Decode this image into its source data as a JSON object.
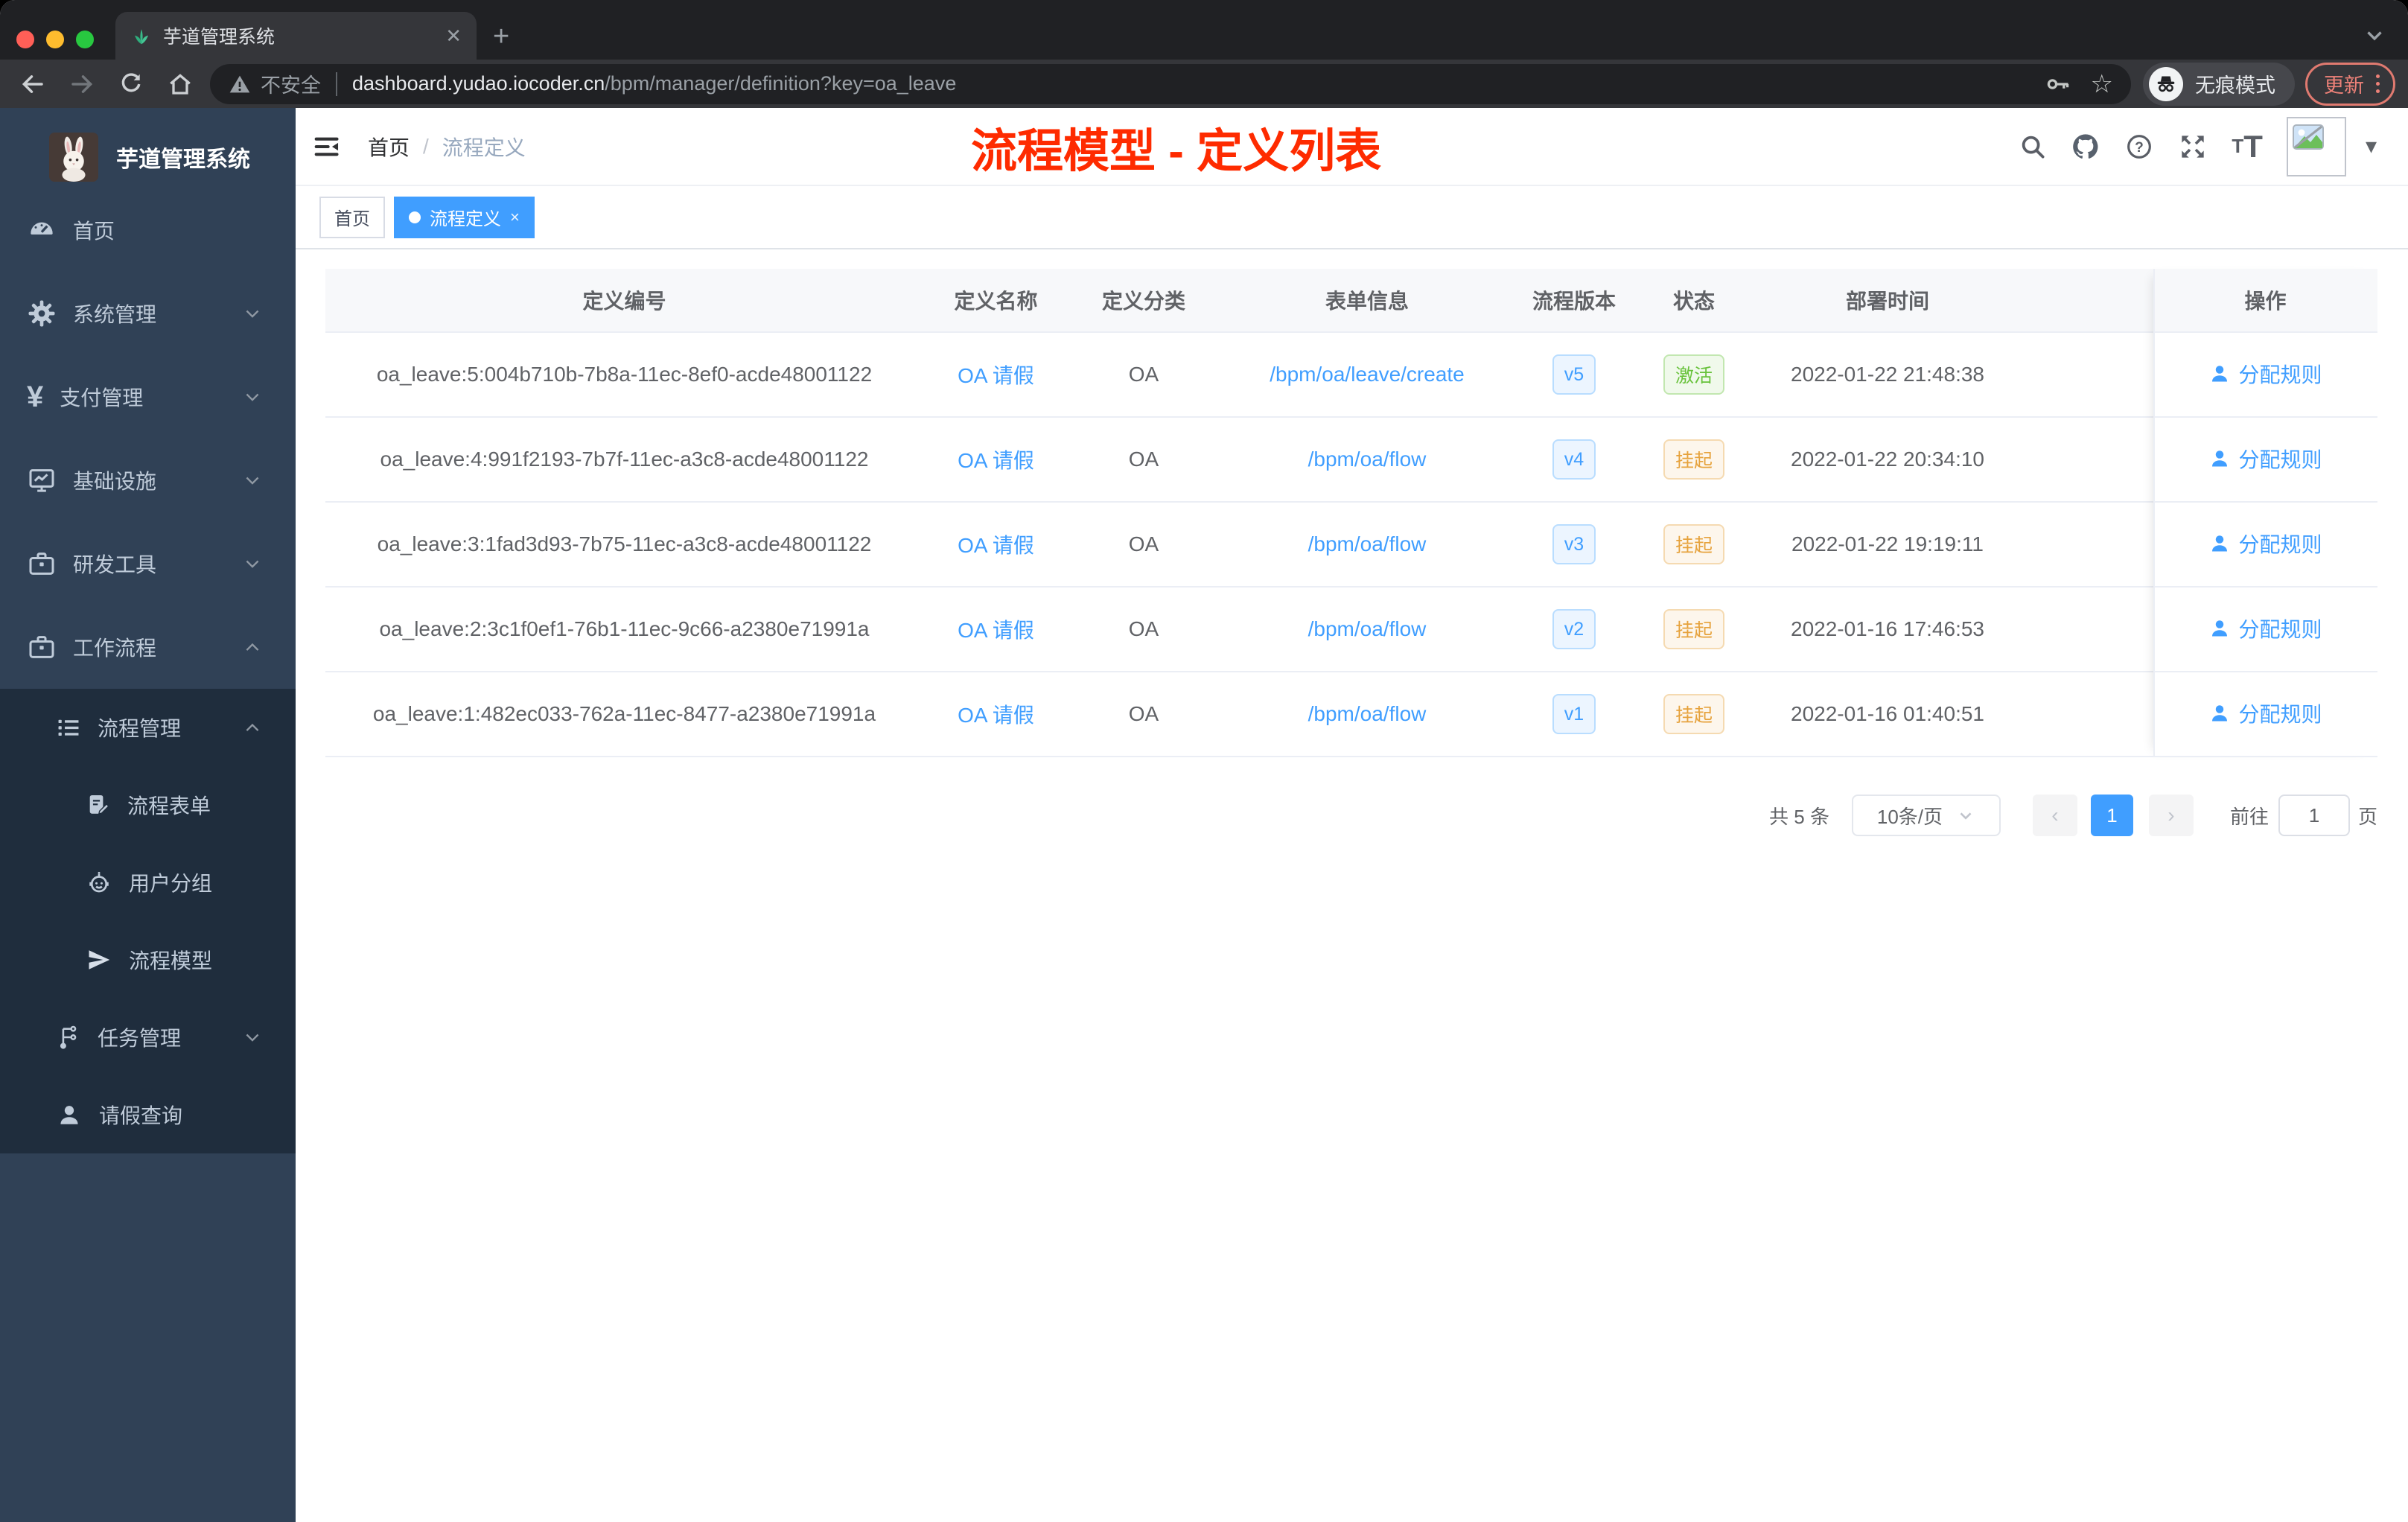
{
  "browser": {
    "tab": {
      "title": "芋道管理系统",
      "favicon": "sprout-icon",
      "close_glyph": "✕",
      "new_tab_glyph": "+"
    },
    "toolbar": {
      "insecure_label": "不安全",
      "url_domain": "dashboard.yudao.iocoder.cn",
      "url_path": "/bpm/manager/definition?key=oa_leave",
      "incognito_label": "无痕模式",
      "update_label": "更新"
    }
  },
  "sidebar": {
    "title": "芋道管理系统",
    "menu": [
      {
        "label": "首页",
        "icon": "dashboard-icon",
        "level": 1
      },
      {
        "label": "系统管理",
        "icon": "gear-icon",
        "level": 1,
        "chevron": "down"
      },
      {
        "label": "支付管理",
        "icon": "yen-icon",
        "level": 1,
        "chevron": "down"
      },
      {
        "label": "基础设施",
        "icon": "monitor-icon",
        "level": 1,
        "chevron": "down"
      },
      {
        "label": "研发工具",
        "icon": "toolbox-icon",
        "level": 1,
        "chevron": "down"
      },
      {
        "label": "工作流程",
        "icon": "briefcase-icon",
        "level": 1,
        "chevron": "up"
      },
      {
        "label": "流程管理",
        "icon": "list-icon",
        "level": 2,
        "chevron": "up",
        "in_submenu": true
      },
      {
        "label": "流程表单",
        "icon": "form-icon",
        "level": 3,
        "in_submenu": true
      },
      {
        "label": "用户分组",
        "icon": "robot-icon",
        "level": 3,
        "in_submenu": true
      },
      {
        "label": "流程模型",
        "icon": "paper-plane-icon",
        "level": 3,
        "in_submenu": true
      },
      {
        "label": "任务管理",
        "icon": "flow-icon",
        "level": 2,
        "chevron": "down",
        "in_submenu": true
      },
      {
        "label": "请假查询",
        "icon": "user-icon",
        "level": 2,
        "in_submenu": true
      }
    ]
  },
  "header": {
    "breadcrumb": {
      "home": "首页",
      "separator": "/",
      "current": "流程定义"
    },
    "annotation": "流程模型 - 定义列表"
  },
  "tags": [
    {
      "label": "首页",
      "active": false,
      "closable": false
    },
    {
      "label": "流程定义",
      "active": true,
      "closable": true
    }
  ],
  "table": {
    "columns": [
      "定义编号",
      "定义名称",
      "定义分类",
      "表单信息",
      "流程版本",
      "状态",
      "部署时间",
      "",
      "操作"
    ],
    "rows": [
      {
        "id": "oa_leave:5:004b710b-7b8a-11ec-8ef0-acde48001122",
        "name": "OA 请假",
        "category": "OA",
        "form": "/bpm/oa/leave/create",
        "version": "v5",
        "status": "激活",
        "status_type": "success",
        "deployed": "2022-01-22 21:48:38",
        "action": "分配规则"
      },
      {
        "id": "oa_leave:4:991f2193-7b7f-11ec-a3c8-acde48001122",
        "name": "OA 请假",
        "category": "OA",
        "form": "/bpm/oa/flow",
        "version": "v4",
        "status": "挂起",
        "status_type": "warning",
        "deployed": "2022-01-22 20:34:10",
        "action": "分配规则"
      },
      {
        "id": "oa_leave:3:1fad3d93-7b75-11ec-a3c8-acde48001122",
        "name": "OA 请假",
        "category": "OA",
        "form": "/bpm/oa/flow",
        "version": "v3",
        "status": "挂起",
        "status_type": "warning",
        "deployed": "2022-01-22 19:19:11",
        "action": "分配规则"
      },
      {
        "id": "oa_leave:2:3c1f0ef1-76b1-11ec-9c66-a2380e71991a",
        "name": "OA 请假",
        "category": "OA",
        "form": "/bpm/oa/flow",
        "version": "v2",
        "status": "挂起",
        "status_type": "warning",
        "deployed": "2022-01-16 17:46:53",
        "action": "分配规则"
      },
      {
        "id": "oa_leave:1:482ec033-762a-11ec-8477-a2380e71991a",
        "name": "OA 请假",
        "category": "OA",
        "form": "/bpm/oa/flow",
        "version": "v1",
        "status": "挂起",
        "status_type": "warning",
        "deployed": "2022-01-16 01:40:51",
        "action": "分配规则"
      }
    ]
  },
  "pagination": {
    "total": "共 5 条",
    "page_size": "10条/页",
    "current_page": "1",
    "goto_label": "前往",
    "goto_value": "1",
    "page_unit": "页"
  },
  "colors": {
    "accent": "#409eff",
    "annotation": "#fe2b00",
    "success": "#67c23a",
    "warning": "#e6a23c",
    "sidebar": "#304156",
    "submenu": "#1f2d3d"
  }
}
